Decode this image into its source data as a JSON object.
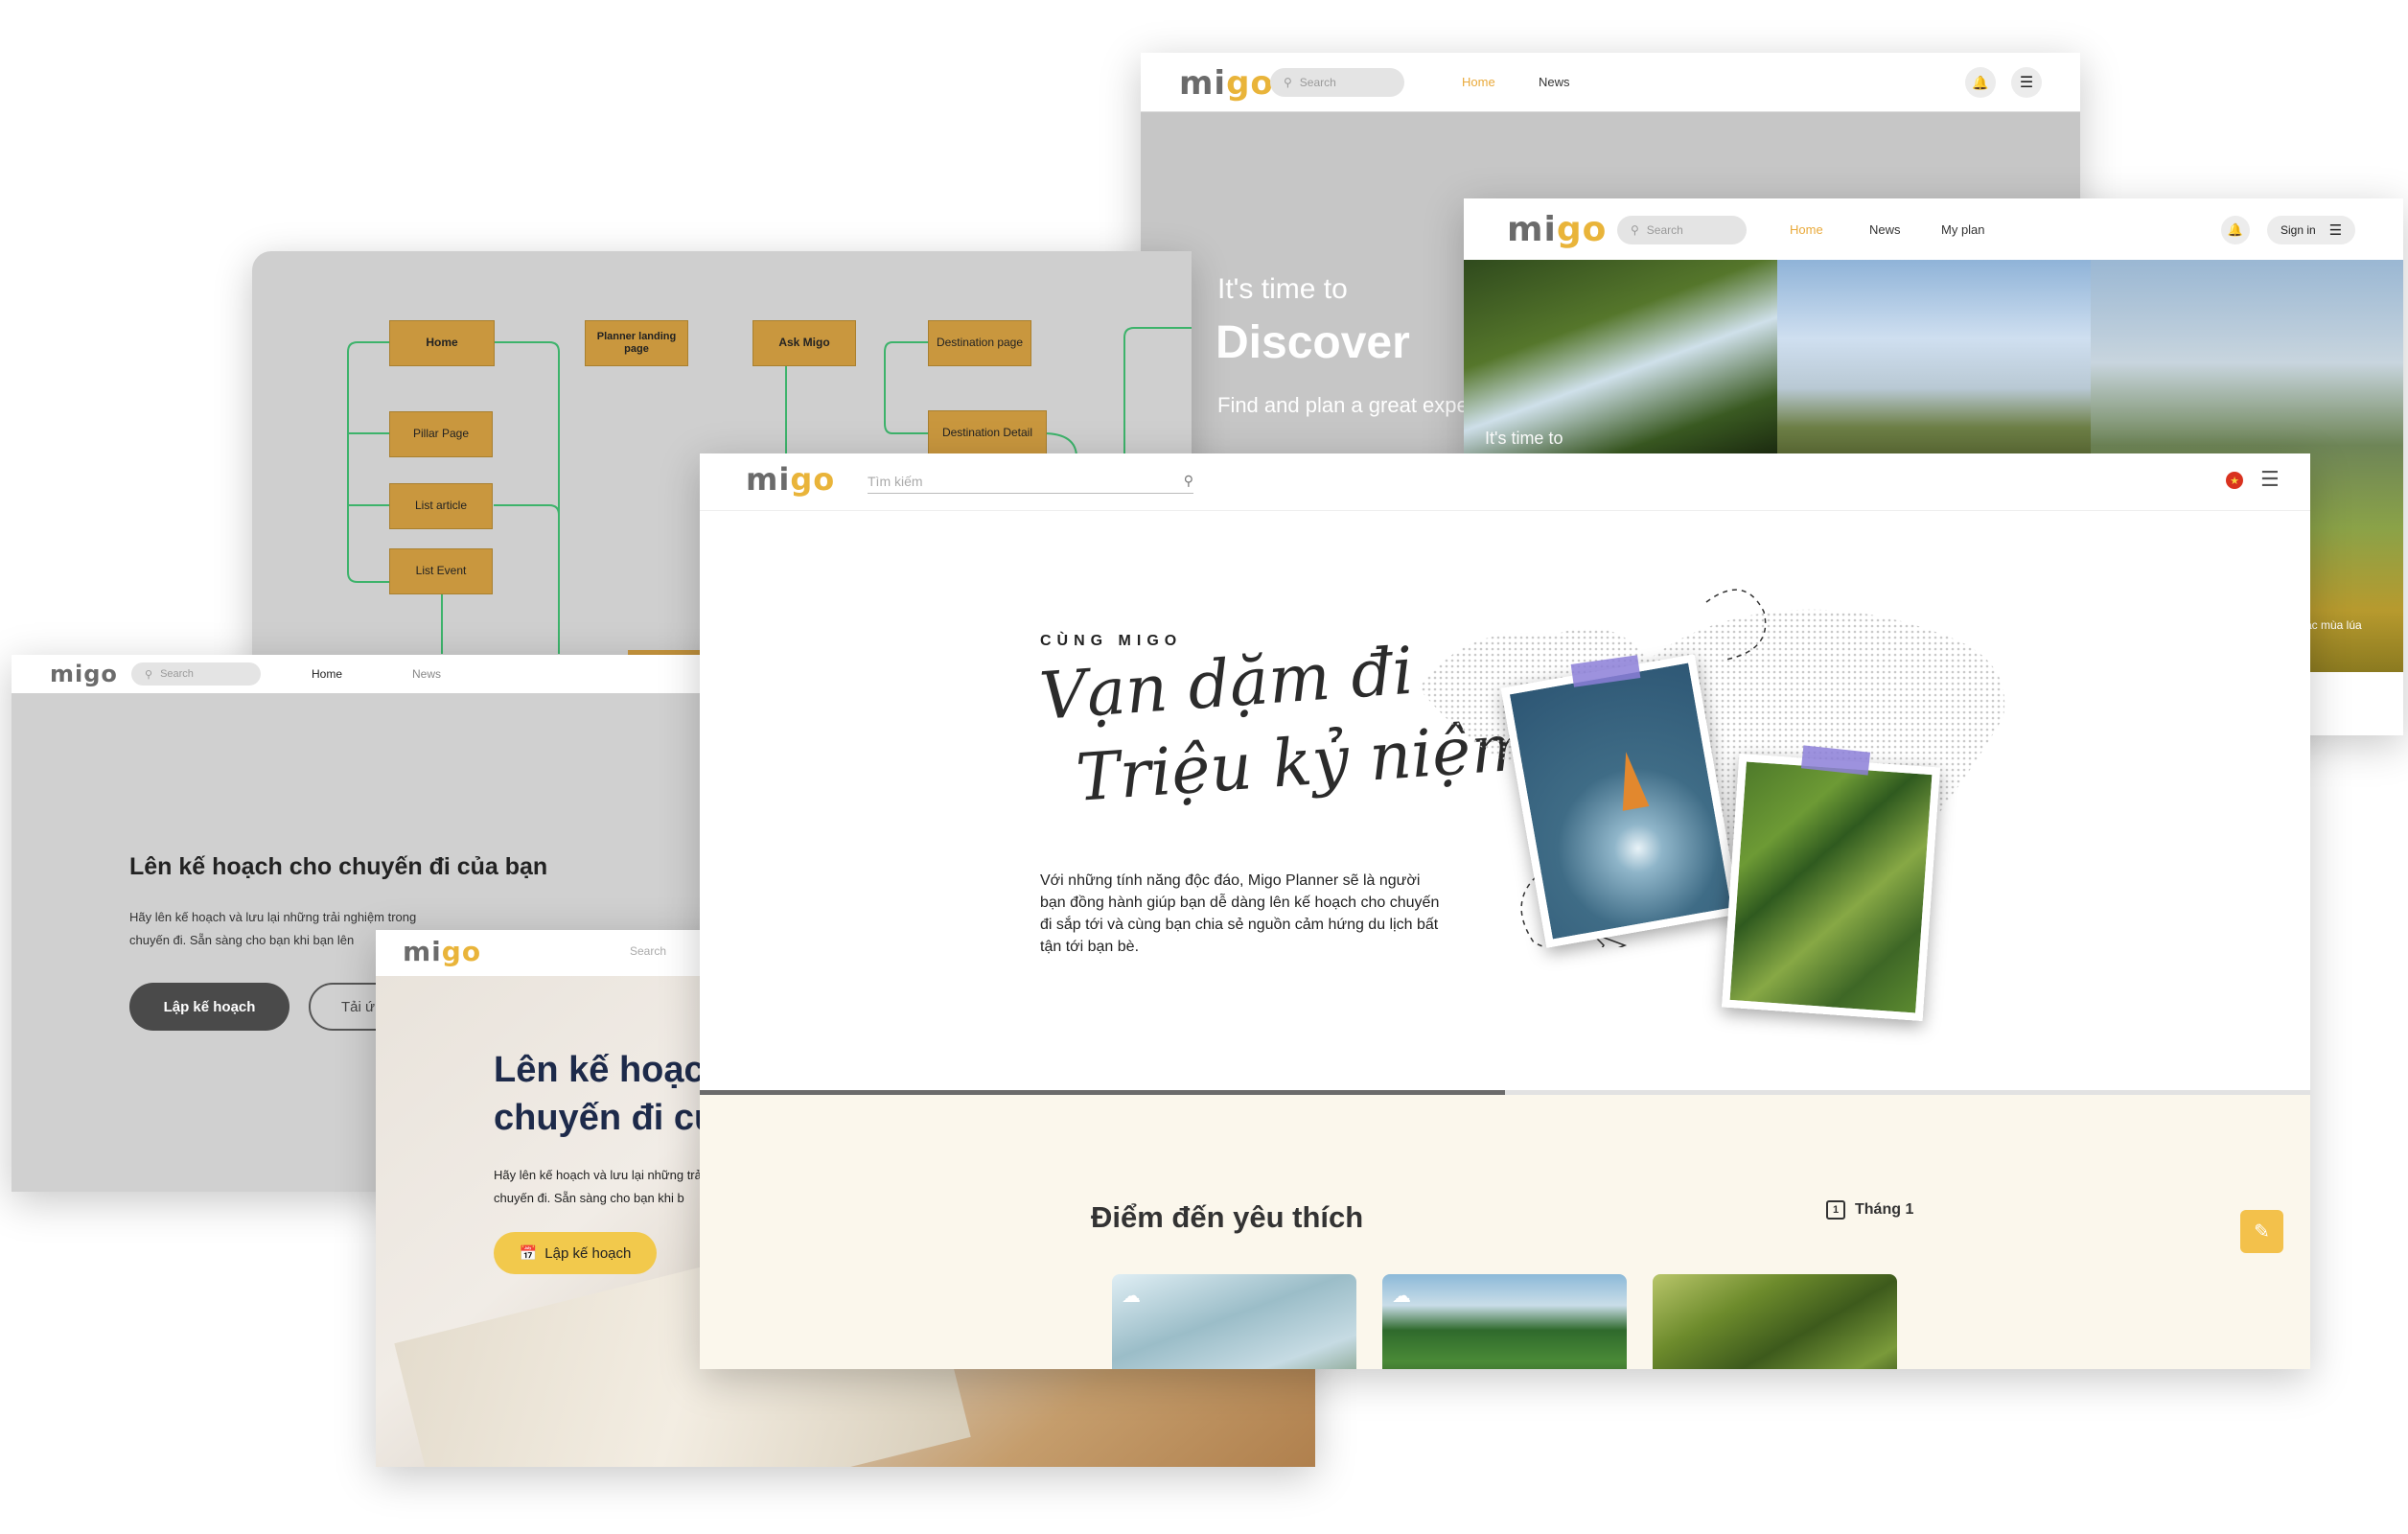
{
  "brand": {
    "logo_a": "mi",
    "logo_b": "go",
    "accent": "#e9b43a",
    "primary_dark": "#4a4a4a",
    "cream_bg": "#fbf7ec"
  },
  "screen_discover": {
    "search_placeholder": "Search",
    "nav": [
      "Home",
      "News"
    ],
    "hero_small": "It's time to",
    "hero_big": "Discover",
    "hero_sub": "Find and plan a great expe"
  },
  "screen_photos": {
    "search_placeholder": "Search",
    "nav": [
      "Home",
      "News",
      "My plan"
    ],
    "signin_label": "Sign in",
    "overlay_text": "It's time to",
    "right_caption": "ặc mùa lúa"
  },
  "sitemap": {
    "boxes": {
      "home": "Home",
      "planner": "Planner landing page",
      "ask": "Ask Migo",
      "dest_page": "Destination page",
      "pillar": "Pillar Page",
      "list_article": "List article",
      "list_event": "List Event",
      "dest_detail": "Destination Detail"
    }
  },
  "screen_planner_wire": {
    "search_placeholder": "Search",
    "nav": [
      "Home",
      "News"
    ],
    "heading": "Lên kế hoạch cho chuyến đi của bạn",
    "body_line1": "Hãy lên kế hoạch và lưu lại những trải nghiệm trong",
    "body_line2": "chuyến đi. Sẵn sàng cho bạn khi bạn lên",
    "primary_button": "Lập kế hoạch",
    "secondary_button": "Tải ứ"
  },
  "screen_planner_photo": {
    "search_placeholder": "Search",
    "heading_line1": "Lên kế hoạc",
    "heading_line2": "chuyến đi củ",
    "body_line1": "Hãy lên kế hoạch và lưu lại những trải nghiệm",
    "body_line2": "chuyến đi. Sẵn sàng cho bạn khi b",
    "cta_button": "Lập kế hoạch"
  },
  "screen_main": {
    "search_placeholder": "Tìm kiếm",
    "eyebrow": "CÙNG MIGO",
    "script_line1": "Vạn dặm đi",
    "script_line2": "Triệu kỷ niệm",
    "description": "Với những tính năng độc đáo, Migo Planner sẽ là người bạn đồng hành giúp bạn dễ dàng lên kế hoạch cho chuyến đi sắp tới và cùng bạn chia sẻ nguồn cảm hứng du lịch bất tận tới bạn bè.",
    "progress_fraction": 0.5,
    "section_title": "Điểm đến yêu thích",
    "month_label": "Tháng 1",
    "calendar_day": "1"
  }
}
